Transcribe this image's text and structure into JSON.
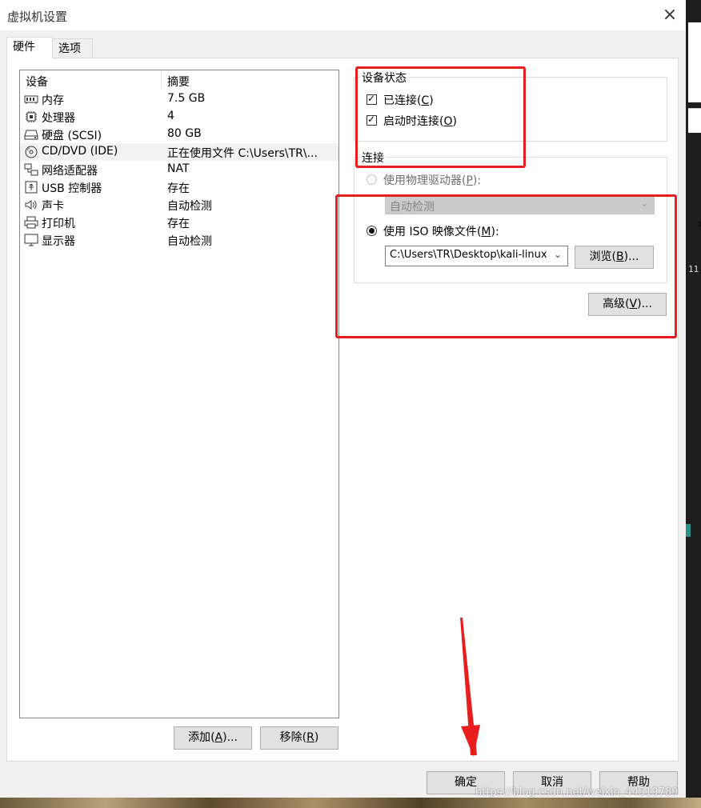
{
  "window": {
    "title": "虚拟机设置"
  },
  "tabs": [
    {
      "label": "硬件"
    },
    {
      "label": "选项"
    }
  ],
  "device_list": {
    "columns": {
      "device": "设备",
      "summary": "摘要"
    },
    "rows": [
      {
        "name": "内存",
        "summary": "7.5 GB",
        "icon": "memory-icon"
      },
      {
        "name": "处理器",
        "summary": "4",
        "icon": "processor-icon"
      },
      {
        "name": "硬盘 (SCSI)",
        "summary": "80 GB",
        "icon": "hard-disk-icon"
      },
      {
        "name": "CD/DVD (IDE)",
        "summary": "正在使用文件 C:\\Users\\TR\\...",
        "icon": "cd-dvd-icon",
        "selected": true
      },
      {
        "name": "网络适配器",
        "summary": "NAT",
        "icon": "network-adapter-icon"
      },
      {
        "name": "USB 控制器",
        "summary": "存在",
        "icon": "usb-icon"
      },
      {
        "name": "声卡",
        "summary": "自动检测",
        "icon": "speaker-icon"
      },
      {
        "name": "打印机",
        "summary": "存在",
        "icon": "printer-icon"
      },
      {
        "name": "显示器",
        "summary": "自动检测",
        "icon": "display-icon"
      }
    ]
  },
  "list_buttons": {
    "add": "添加",
    "add_key": "A",
    "remove": "移除",
    "remove_key": "R"
  },
  "device_status": {
    "title": "设备状态",
    "connected": {
      "label": "已连接",
      "key": "C",
      "checked": true
    },
    "connect_at_power_on": {
      "label": "启动时连接",
      "key": "O",
      "checked": true
    }
  },
  "connection": {
    "title": "连接",
    "physical_drive": {
      "label": "使用物理驱动器",
      "key": "P",
      "selected": false,
      "enabled": false,
      "value": "自动检测"
    },
    "iso_image": {
      "label": "使用 ISO 映像文件",
      "key": "M",
      "selected": true,
      "path": "C:\\Users\\TR\\Desktop\\kali-linux"
    },
    "browse": {
      "label": "浏览",
      "key": "B"
    }
  },
  "advanced": {
    "label": "高级",
    "key": "V"
  },
  "footer": {
    "ok": "确定",
    "cancel": "取消",
    "help": "帮助"
  },
  "watermark": "https://blog.csdn.net/weixin_44519789",
  "background": {
    "number_text": "11"
  },
  "colors": {
    "annotation_red": "#e81e1e",
    "selected_row": "#f2f2f2",
    "dialog_bg": "#f0f0f0"
  }
}
